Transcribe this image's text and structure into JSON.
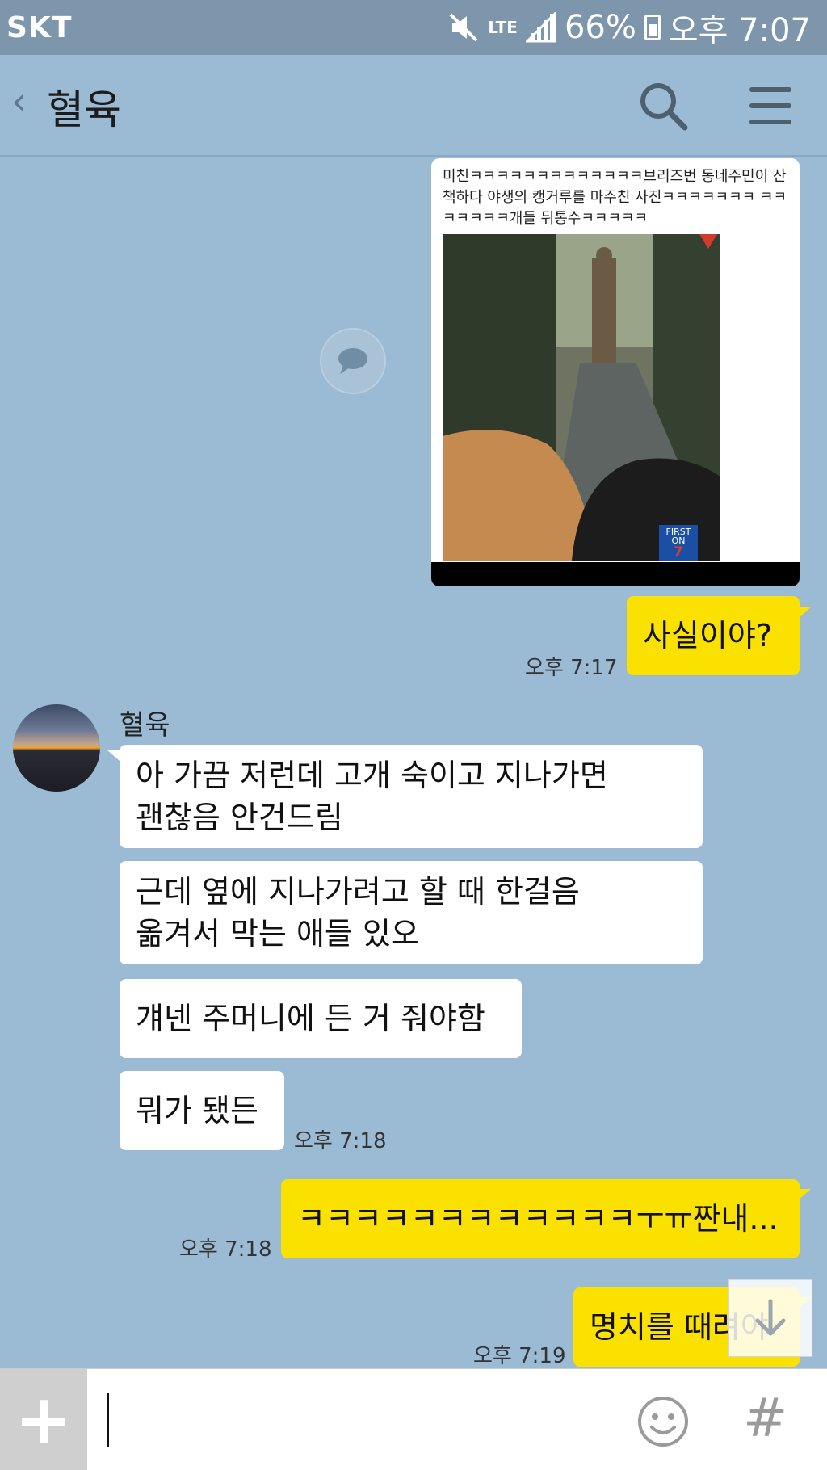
{
  "status_bar": {
    "carrier": "SKT",
    "network": "LTE",
    "battery": "66%",
    "time": "오후 7:07",
    "icons": [
      "mute-icon",
      "lte-icon",
      "signal-icon",
      "battery-icon"
    ]
  },
  "header": {
    "back_glyph": "‹",
    "title": "혈육",
    "icons": [
      "search-icon",
      "menu-icon"
    ]
  },
  "messages": {
    "image_caption": "미친ㅋㅋㅋㅋㅋㅋㅋㅋㅋㅋㅋㅋㅋ브리즈번 동네주민이 산책하다 야생의 캥거루를 마주친 사진ㅋㅋㅋㅋㅋㅋㅋ ㅋㅋㅋㅋㅋㅋㅋ개들 뒤통수ㅋㅋㅋㅋㅋ",
    "image_badge_line1": "FIRST",
    "image_badge_line2": "ON",
    "image_badge_num": "7",
    "m1": {
      "text": "사실이야?",
      "time": "오후 7:17"
    },
    "sender_name": "혈육",
    "r1_line1": "아 가끔 저런데 고개 숙이고 지나가면",
    "r1_line2": "괜찮음 안건드림",
    "r2_line1": "근데 옆에 지나가려고 할 때 한걸음",
    "r2_line2": "옮겨서 막는 애들 있오",
    "r3": "걔넨 주머니에 든 거 줘야함",
    "r4": "뭐가 됐든",
    "r_time": "오후 7:18",
    "m2": {
      "text": "ㅋㅋㅋㅋㅋㅋㅋㅋㅋㅋㅋㅋㅜㅠ짠내...",
      "time": "오후 7:18"
    },
    "m3": {
      "text": "명치를 때려야",
      "time": "오후 7:19"
    }
  },
  "input_bar": {
    "plus": "+",
    "hash": "#"
  },
  "colors": {
    "chat_background": "#9bbbd4",
    "my_bubble": "#fae100",
    "their_bubble": "#ffffff",
    "status_bar": "#7d96ac"
  }
}
